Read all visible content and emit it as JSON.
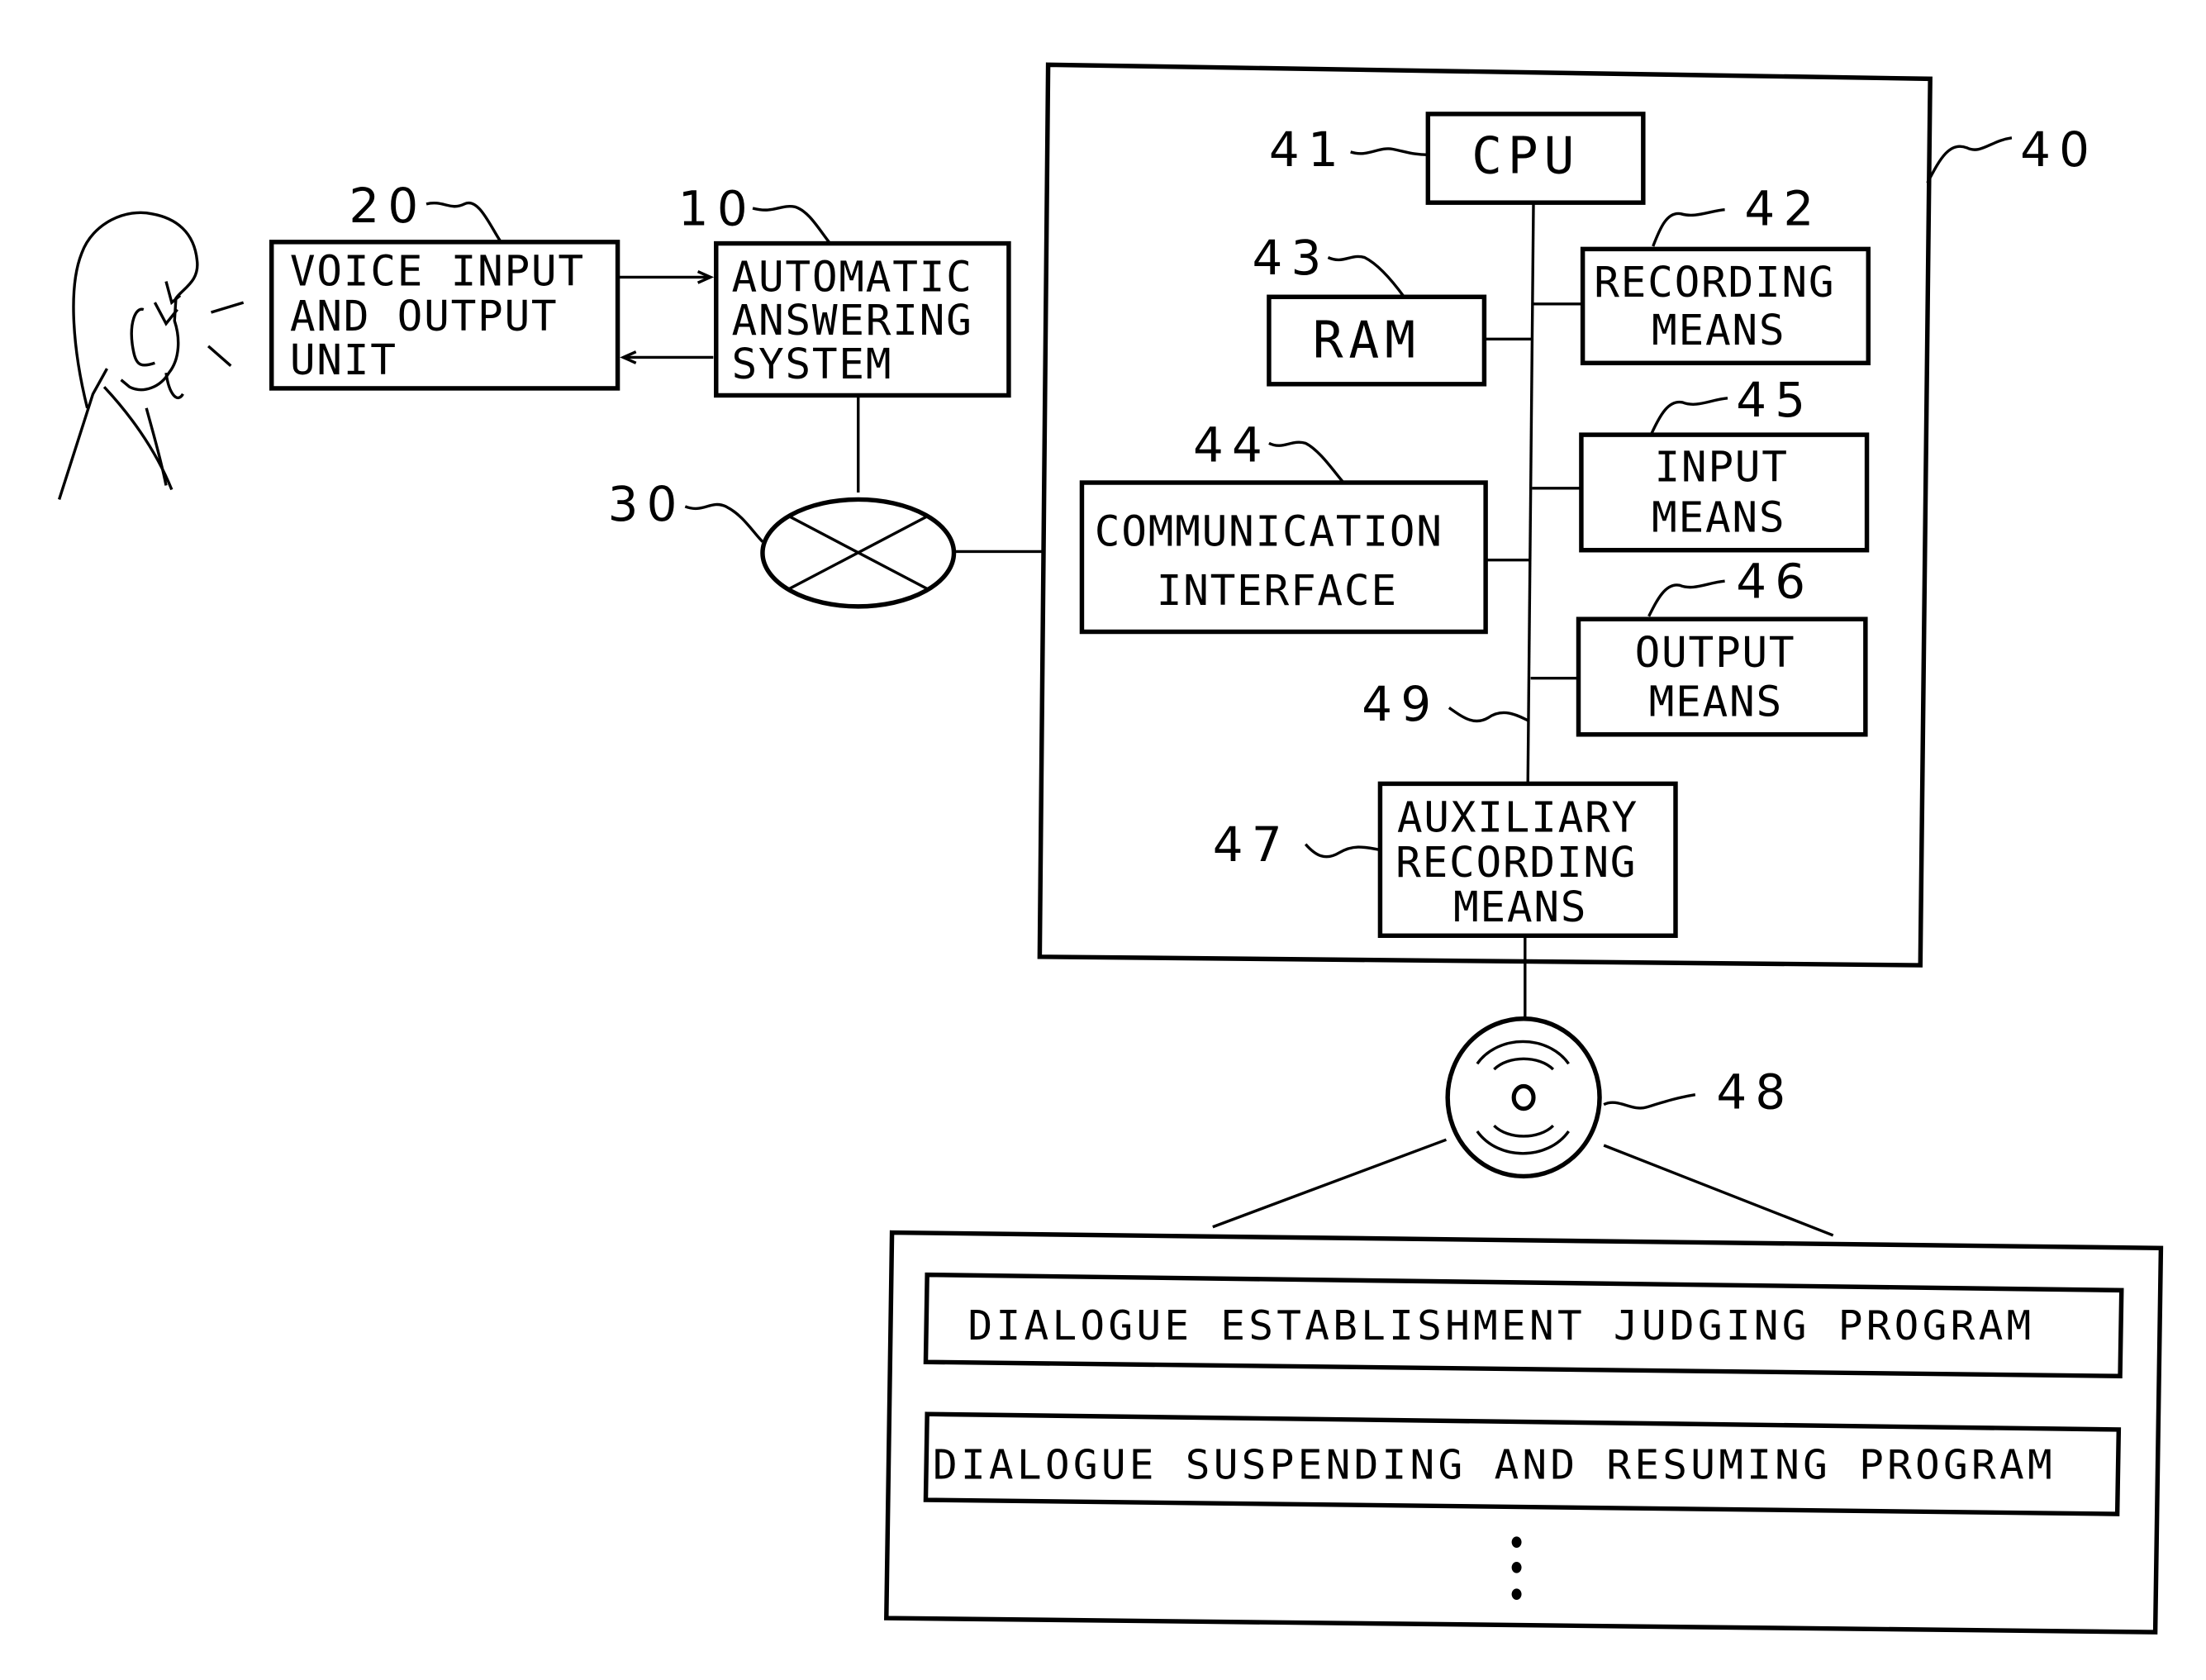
{
  "figure": {
    "user": {
      "icon": "person-speaking-icon"
    },
    "voice_unit": {
      "ref": "20",
      "lines": [
        "VOICE INPUT",
        "AND OUTPUT",
        "UNIT"
      ]
    },
    "answering_system": {
      "ref": "10",
      "lines": [
        "AUTOMATIC",
        "ANSWERING",
        "SYSTEM"
      ]
    },
    "network": {
      "ref": "30",
      "icon": "network-crossed-ellipse-icon"
    },
    "computer": {
      "ref": "40",
      "cpu": {
        "ref": "41",
        "label": "CPU"
      },
      "recording": {
        "ref": "42",
        "lines": [
          "RECORDING",
          "MEANS"
        ]
      },
      "ram": {
        "ref": "43",
        "label": "RAM"
      },
      "comm_interface": {
        "ref": "44",
        "lines": [
          "COMMUNICATION",
          "INTERFACE"
        ]
      },
      "input": {
        "ref": "45",
        "lines": [
          "INPUT",
          "MEANS"
        ]
      },
      "output": {
        "ref": "46",
        "lines": [
          "OUTPUT",
          "MEANS"
        ]
      },
      "aux_recording": {
        "ref": "47",
        "lines": [
          "AUXILIARY",
          "RECORDING",
          "MEANS"
        ]
      },
      "bus": {
        "ref": "49"
      }
    },
    "disk": {
      "ref": "48",
      "icon": "disk-icon"
    },
    "programs": {
      "items": [
        "DIALOGUE ESTABLISHMENT JUDGING PROGRAM",
        "DIALOGUE SUSPENDING AND RESUMING PROGRAM"
      ],
      "more_indicator": "vertical-ellipsis-icon"
    }
  }
}
